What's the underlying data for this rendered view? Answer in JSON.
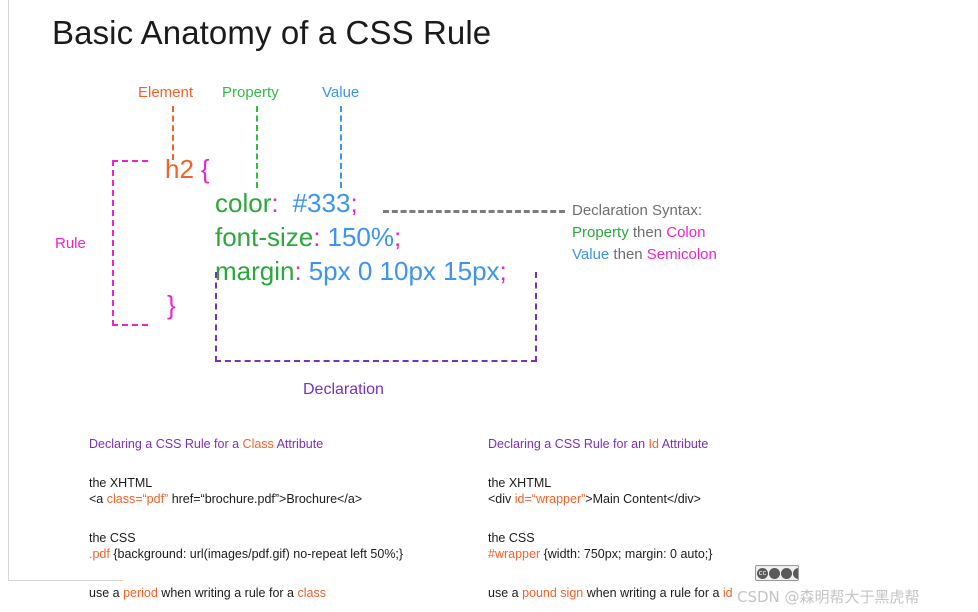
{
  "slide": {
    "title": "Basic Anatomy of a CSS Rule"
  },
  "annotations": {
    "element_label": "Element",
    "property_label": "Property",
    "value_label": "Value",
    "rule_label": "Rule",
    "declaration_label": "Declaration"
  },
  "code": {
    "selector": "h2",
    "open_brace": "{",
    "close_brace": "}",
    "declarations": [
      {
        "property": "color",
        "colon": ":",
        "value": "#333",
        "semicolon": ";"
      },
      {
        "property": "font-size",
        "colon": ":",
        "value": "150%",
        "semicolon": ";"
      },
      {
        "property": "margin",
        "colon": ":",
        "value": "5px 0 10px 15px",
        "semicolon": ";"
      }
    ]
  },
  "declaration_syntax": {
    "heading": "Declaration Syntax:",
    "line1_a": "Property",
    "line1_b": " then ",
    "line1_c": "Colon",
    "line2_a": "Value",
    "line2_b": " then ",
    "line2_c": "Semicolon"
  },
  "class_section": {
    "heading_a": "Declaring a CSS Rule for a ",
    "heading_b": "Class",
    "heading_c": " Attribute",
    "xhtml_label": "the XHTML",
    "xhtml_code_a": "<a ",
    "xhtml_code_b": "class=“pdf”",
    "xhtml_code_c": " href=“brochure.pdf”>Brochure</a>",
    "css_label": "the CSS",
    "css_code_a": ".pdf",
    "css_code_b": " {background: url(images/pdf.gif) no-repeat left 50%;}",
    "note_a": "use a ",
    "note_b": "period",
    "note_c": " when writing a rule for a ",
    "note_d": "class"
  },
  "id_section": {
    "heading_a": "Declaring a CSS Rule for an ",
    "heading_b": "Id",
    "heading_c": " Attribute",
    "xhtml_label": "the XHTML",
    "xhtml_code_a": "<div ",
    "xhtml_code_b": "id=“wrapper”",
    "xhtml_code_c": ">Main Content</div>",
    "css_label": "the CSS",
    "css_code_a": "#wrapper",
    "css_code_b": " {width: 750px; margin: 0 auto;}",
    "note_a": "use a ",
    "note_b": "pound sign",
    "note_c": " when writing a rule for a ",
    "note_d": "id"
  },
  "footer": {
    "watermark": "CSDN @森明帮大于黑虎帮",
    "cc_badge_label": "cc"
  },
  "colors": {
    "element_orange": "#f4622a",
    "property_green": "#2aa83a",
    "value_blue": "#3c94f0",
    "punct_magenta": "#ee22cc",
    "rule_magenta": "#ee22cc",
    "declaration_purple": "#7b2fbe",
    "leader_gray": "#7d7d7d",
    "body_text": "#1b1b1b"
  }
}
